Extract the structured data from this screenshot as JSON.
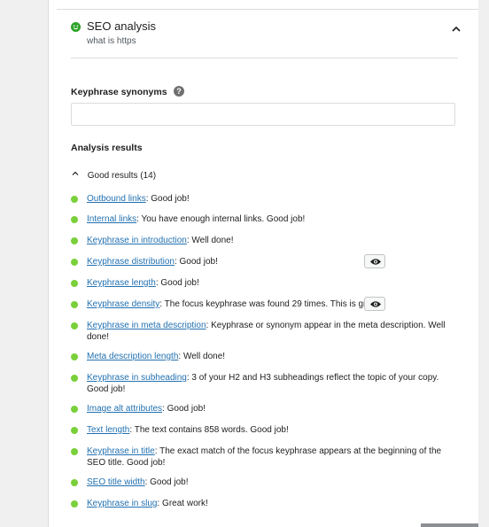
{
  "seo": {
    "title": "SEO analysis",
    "subtitle": "what is https"
  },
  "synonyms": {
    "label": "Keyphrase synonyms",
    "help_icon": "?",
    "value": "",
    "placeholder": ""
  },
  "analysis": {
    "title": "Analysis results",
    "good_label": "Good results (14)",
    "items": [
      {
        "link": "Outbound links",
        "text": ": Good job!"
      },
      {
        "link": "Internal links",
        "text": ": You have enough internal links. Good job!"
      },
      {
        "link": "Keyphrase in introduction",
        "text": ": Well done!"
      },
      {
        "link": "Keyphrase distribution",
        "text": ": Good job!"
      },
      {
        "link": "Keyphrase length",
        "text": ": Good job!"
      },
      {
        "link": "Keyphrase density",
        "text": ": The focus keyphrase was found 29 times. This is great!"
      },
      {
        "link": "Keyphrase in meta description",
        "text": ": Keyphrase or synonym appear in the meta description. Well done!"
      },
      {
        "link": "Meta description length",
        "text": ": Well done!"
      },
      {
        "link": "Keyphrase in subheading",
        "text": ": 3 of your H2 and H3 subheadings reflect the topic of your copy. Good job!"
      },
      {
        "link": "Image alt attributes",
        "text": ": Good job!"
      },
      {
        "link": "Text length",
        "text": ": The text contains 858 words. Good job!"
      },
      {
        "link": "Keyphrase in title",
        "text": ": The exact match of the focus keyphrase appears at the beginning of the SEO title. Good job!"
      },
      {
        "link": "SEO title width",
        "text": ": Good job!"
      },
      {
        "link": "Keyphrase in slug",
        "text": ": Great work!"
      }
    ]
  },
  "colors": {
    "good": "#7ad03a",
    "link": "#2271b1",
    "smiley": "#2ea42a"
  },
  "icons": {
    "header": "smiley-icon",
    "collapse": "chevron-up-icon",
    "help": "question-mark-icon",
    "toggle": "chevron-up-icon",
    "marker": "eye-icon"
  }
}
